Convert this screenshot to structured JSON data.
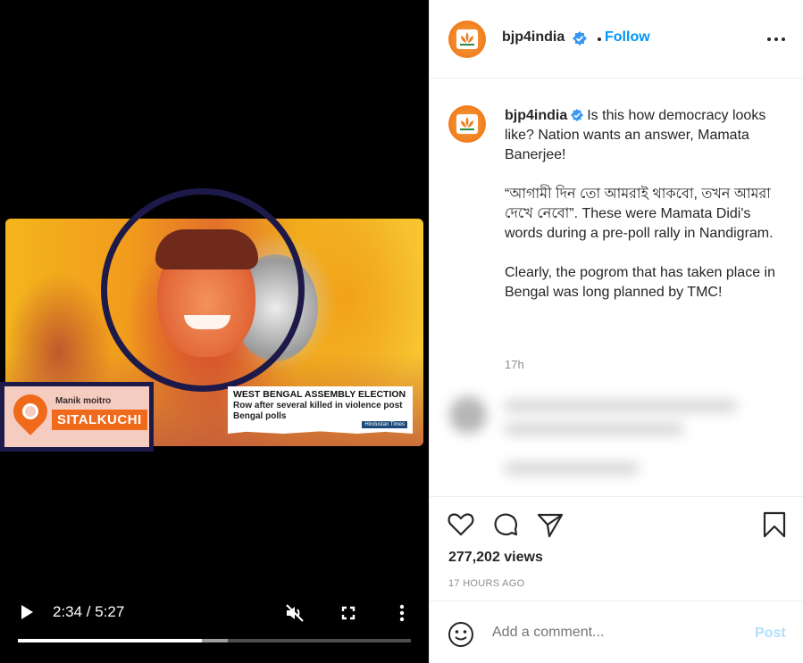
{
  "video": {
    "overlay": {
      "location_name": "Manik moitro",
      "location_place": "SITALKUCHI",
      "news_headline": "WEST BENGAL ASSEMBLY ELECTION",
      "news_body": "Row after several killed in violence post Bengal polls",
      "news_logo": "Hindustan Times"
    },
    "time_display": "2:34 / 5:27",
    "progress_fraction": 0.469,
    "buffered_fraction": 0.534,
    "icons": [
      "play-icon",
      "mute-icon",
      "fullscreen-icon",
      "more-vertical-icon"
    ]
  },
  "post_header": {
    "username": "bjp4india",
    "follow_label": "Follow"
  },
  "caption": {
    "username": "bjp4india",
    "paragraph1": "Is this how democracy looks like? Nation wants an answer, Mamata Banerjee!",
    "paragraph2": "“আগামী দিন তো আমরাই থাকবো, তখন আমরা দেখে নেবো”. These were Mamata Didi's words during a pre-poll rally in Nandigram.",
    "paragraph3": "Clearly, the pogrom that has taken place in Bengal was long planned by TMC!",
    "time": "17h"
  },
  "engagement": {
    "views": "277,202 views",
    "posted_ago": "17 HOURS AGO"
  },
  "comment_box": {
    "placeholder": "Add a comment...",
    "post_label": "Post"
  },
  "colors": {
    "accent": "#0095f6",
    "post_disabled": "#b2dffc",
    "frame_border": "#1d1a4a",
    "marker_orange": "#f06a1b"
  }
}
